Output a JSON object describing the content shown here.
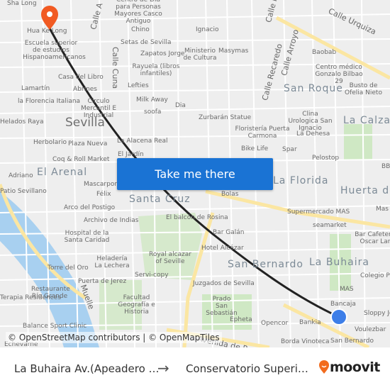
{
  "map": {
    "labels": [
      "Sha Long",
      "Hua Ke Long",
      "Escuela superior de estudios Hispanoamericanos",
      "Calle A",
      "Centro de Día para Personas Mayores Casco Antiguo",
      "Chino",
      "Setas de Sevilla",
      "Calle Cuna",
      "Zapatos Jorge",
      "Ministerio de Cultura",
      "Ignacio",
      "Masymas",
      "Rayuela (libros infantiles)",
      "Casa del Libro",
      "Lamartín",
      "Abrines",
      "Lefties",
      "Milk Away",
      "la Florencia Italiana",
      "Circulo Mercantil E Industrial",
      "Dia",
      "soofa",
      "Helados Raya",
      "Sevilla",
      "Herbolario",
      "Plaza Nueva",
      "La Alacena Real",
      "El Jardín",
      "Coq & Roll Market",
      "El Arenal",
      "Adriano",
      "Mascarpone",
      "Patio Sevillano",
      "Félix",
      "Arco del Postigo",
      "Santa Cruz",
      "Archivo de Indias",
      "Hospital de la Santa Caridad",
      "El balcón de Rosina",
      "Bar Galán",
      "Heladería La Lechera",
      "Torre del Oro",
      "Royal alcazar of Seville",
      "Hotel Alcázar",
      "Servi-copy",
      "Puerta de Jerez",
      "San Bernardo",
      "Juzgados de Sevilla",
      "Terapia Residences",
      "Restaurante Río Grande",
      "Facultad Geografía e Historia",
      "Prado San Sebastián",
      "Epheta",
      "Opencor",
      "Bankia",
      "Balance Sport Clinic",
      "Echevarne",
      "Calle Urquiza",
      "Baobab",
      "Calle Recaredo",
      "Calle Arroyo",
      "Centro médico Gonzalo Bilbao 29",
      "San Roque",
      "Busto de Ofelia Nieto",
      "Clina Urologica San Ignacio",
      "La Calzada",
      "La Dehesa",
      "Floristería Puerta Carmona",
      "Zurbarán Statue",
      "Bike Life",
      "Spar",
      "Pelostop",
      "La Florida",
      "Huerta del",
      "Bolas",
      "Supermercado MAS",
      "Mas",
      "seamarket",
      "Bar Cafetería Oscar Lan",
      "La Buhaira",
      "Colegio Po",
      "MAS",
      "Bancaja",
      "Sloppy Jo",
      "Voulezbar",
      "Borda Vinoteca",
      "San Bernardo",
      "Muelle",
      "Avenida de Portugal",
      "Calle Ma",
      "BBV"
    ],
    "attribution": "© OpenStreetMap contributors | © OpenMapTiles",
    "cta_label": "Take me there",
    "colors": {
      "route": "#222222",
      "origin": "#3d7ee8",
      "destination": "#f15a22",
      "cta": "#1a73d4",
      "river": "#a8d0f0",
      "park": "#cfe8c4",
      "major_road": "#fbe6a2"
    }
  },
  "trip": {
    "from": "La Buhaira Av.(Apeadero …",
    "arrow": "→",
    "to": "Conservatorio Superi…",
    "brand": "moovit"
  }
}
